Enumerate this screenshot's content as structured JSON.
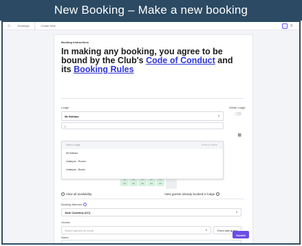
{
  "slide": {
    "title": "New Booking – Make a new booking"
  },
  "appbar": {
    "home_icon": "home-icon",
    "breadcrumbs": [
      "Bookings",
      "Create New"
    ]
  },
  "instructions": {
    "label": "Booking Instructions",
    "text_before": "In making any booking, you agree to be bound by the Club's ",
    "link1": "Code of Conduct",
    "text_middle": " and its ",
    "link2": "Booking Rules"
  },
  "lodge": {
    "label": "Lodge",
    "value": "Mt Hotham",
    "search_value": "|",
    "whole_lodge_label": "Whole Lodge",
    "options_header": "Select Lodge",
    "options_header_hint": "Press to select",
    "options": [
      "Mt Hotham",
      "Indiskyne - Rooms",
      "Indiskyne - Bunks"
    ]
  },
  "calendar": {
    "cells": [
      "24",
      "24",
      "24",
      "24",
      "24"
    ],
    "cell_labels": [
      "18",
      "19",
      "20",
      "21",
      "22"
    ]
  },
  "availability": {
    "view_all": "View all availability",
    "view_guests": "View guests already booked in lodge"
  },
  "booking_member": {
    "label": "Booking Member",
    "value": "Jane Courtney (CC)"
  },
  "guests": {
    "label": "Guests",
    "placeholder": "Search guests by name",
    "enrol_button": "Enrol new guest"
  },
  "notes": {
    "label": "Notes"
  },
  "submit": {
    "label": "Submit"
  },
  "colors": {
    "header": "#2c4a63",
    "accent": "#6c4de6",
    "link": "#2f36d6",
    "available": "#d9f2e1"
  }
}
